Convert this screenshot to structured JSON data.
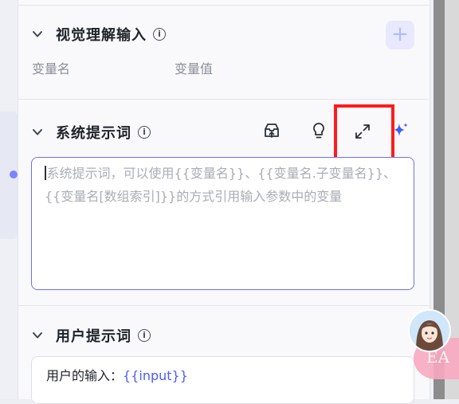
{
  "vision_section": {
    "title": "视觉理解输入",
    "col_name": "变量名",
    "col_value": "变量值",
    "add_label": "+"
  },
  "system_prompt_section": {
    "title": "系统提示词",
    "placeholder": "系统提示词，可以使用{{变量名}}、{{变量名.子变量名}}、{{变量名[数组索引]}}的方式引用输入参数中的变量"
  },
  "user_prompt_section": {
    "title": "用户提示词",
    "text_prefix": "用户的输入：",
    "variable_token": "{{input}}"
  },
  "toolbar_icons": [
    "prompt-library-icon",
    "lightbulb-icon",
    "expand-icon",
    "sparkle-icon"
  ],
  "overlay": {
    "badge_text": "EA"
  },
  "colors": {
    "accent": "#4b5cff",
    "highlight_box": "#ff1b1b",
    "textarea_border": "#6f72e6"
  }
}
